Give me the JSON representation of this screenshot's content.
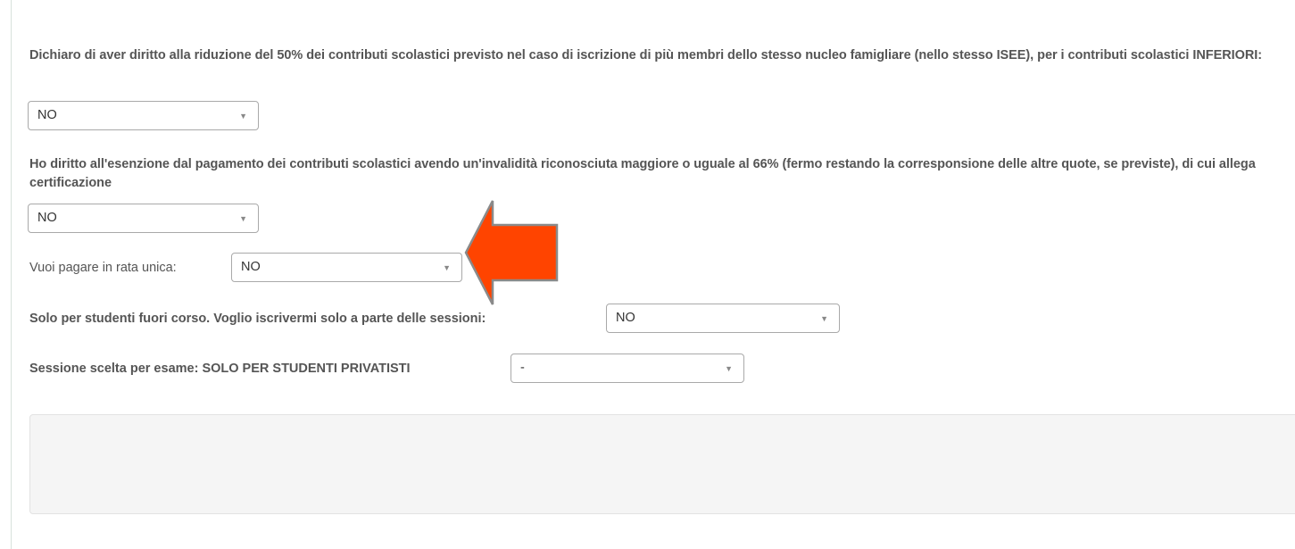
{
  "q1": {
    "text": "Dichiaro di aver diritto alla riduzione del 50% dei contributi scolastici previsto nel caso di iscrizione di più membri dello stesso nucleo famigliare (nello stesso ISEE), per i contributi scolastici INFERIORI:",
    "value": "NO"
  },
  "q2": {
    "text": "Ho diritto all'esenzione dal pagamento dei contributi scolastici avendo un'invalidità riconosciuta maggiore o uguale al 66% (fermo restando la corresponsione delle altre quote, se previste), di cui allega certificazione",
    "value": "NO"
  },
  "q3": {
    "label": "Vuoi pagare in rata unica:",
    "value": "NO"
  },
  "q4": {
    "label": "Solo per studenti fuori corso. Voglio iscrivermi solo a parte delle sessioni:",
    "value": "NO"
  },
  "q5": {
    "label": "Sessione scelta per esame: SOLO PER STUDENTI PRIVATISTI",
    "value": "-"
  },
  "caret": "▼",
  "colors": {
    "arrow_fill": "#ff4400",
    "arrow_stroke": "#8a8a8a",
    "panel_bg": "#f5f5f5"
  },
  "icons": {
    "select_caret": "chevron-down-icon",
    "annotation": "arrow-left-icon"
  }
}
